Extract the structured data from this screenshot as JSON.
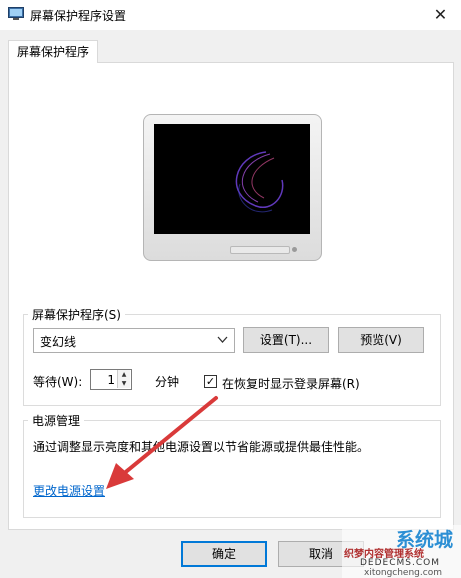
{
  "window": {
    "title": "屏幕保护程序设置",
    "close_glyph": "✕"
  },
  "tabs": [
    {
      "label": "屏幕保护程序"
    }
  ],
  "screensaver": {
    "group_label": "屏幕保护程序(S)",
    "selected": "变幻线",
    "settings_button": "设置(T)...",
    "preview_button": "预览(V)",
    "wait_label": "等待(W):",
    "wait_value": "1",
    "wait_unit": "分钟",
    "resume_label": "在恢复时显示登录屏幕(R)",
    "resume_checked": true
  },
  "power": {
    "group_label": "电源管理",
    "description": "通过调整显示亮度和其他电源设置以节省能源或提供最佳性能。",
    "link": "更改电源设置"
  },
  "footer": {
    "ok_button": "确定",
    "cancel_button": "取消"
  },
  "watermark": {
    "brand": "系统城",
    "line1": "织梦内容管理系统",
    "line2": "DEDECMS.COM",
    "line3": "xitongcheng.com"
  },
  "colors": {
    "accent_link": "#0066cc",
    "arrow": "#d93a3a",
    "default_button_border": "#0078d7"
  },
  "icons": [
    "monitor-icon",
    "close-icon",
    "dropdown-arrow-icon",
    "spin-up-icon",
    "spin-down-icon",
    "check-icon",
    "annotation-arrow"
  ]
}
